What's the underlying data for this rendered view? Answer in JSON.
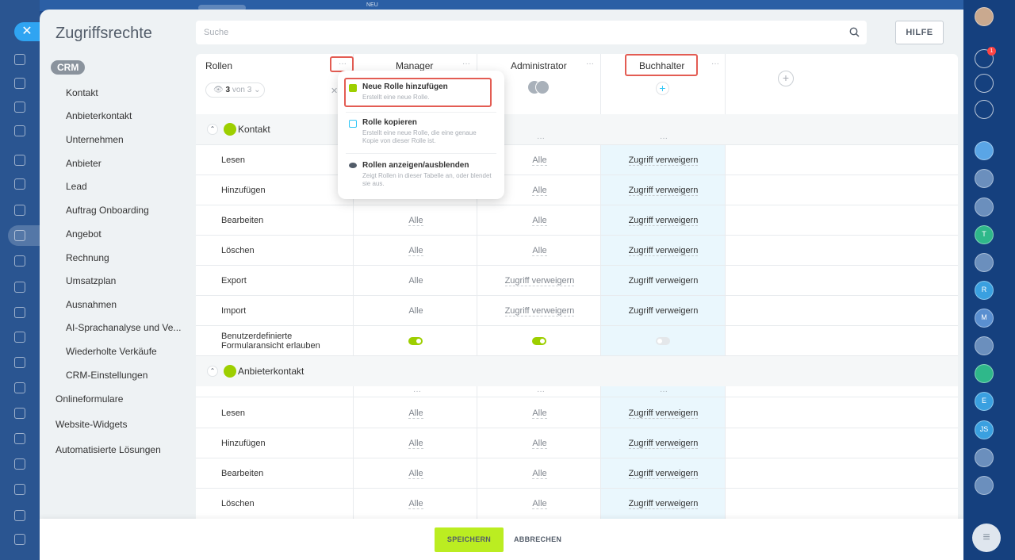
{
  "panel": {
    "title": "Zugriffsrechte",
    "search_placeholder": "Suche",
    "help_label": "HILFE"
  },
  "topbar": {
    "new_label": "NEU"
  },
  "nav": {
    "crm_label": "CRM",
    "crm_items": [
      "Kontakt",
      "Anbieterkontakt",
      "Unternehmen",
      "Anbieter",
      "Lead",
      "Auftrag Onboarding",
      "Angebot",
      "Rechnung",
      "Umsatzplan",
      "Ausnahmen",
      "AI-Sprachanalyse und Ve...",
      "Wiederholte Verkäufe",
      "CRM-Einstellungen"
    ],
    "top_items": [
      "Onlineformulare",
      "Website-Widgets",
      "Automatisierte Lösungen"
    ]
  },
  "table": {
    "roles_header": "Rollen",
    "count": "3",
    "count_suffix": "von 3",
    "columns": [
      "Manager",
      "Administrator",
      "Buchhalter"
    ],
    "sections": [
      {
        "title": "Kontakt",
        "rows": [
          {
            "label": "Lesen",
            "values": [
              "",
              "Alle",
              "Zugriff verweigern"
            ]
          },
          {
            "label": "Hinzufügen",
            "values": [
              "",
              "Alle",
              "Zugriff verweigern"
            ]
          },
          {
            "label": "Bearbeiten",
            "values": [
              "Alle",
              "Alle",
              "Zugriff verweigern"
            ]
          },
          {
            "label": "Löschen",
            "values": [
              "Alle",
              "Alle",
              "Zugriff verweigern"
            ]
          },
          {
            "label": "Export",
            "values": [
              "Alle",
              "Zugriff verweigern",
              "Zugriff verweigern"
            ]
          },
          {
            "label": "Import",
            "values": [
              "Alle",
              "Zugriff verweigern",
              "Zugriff verweigern"
            ]
          },
          {
            "label": "Benutzerdefinierte Formularansicht erlauben",
            "toggles": [
              true,
              true,
              false
            ]
          }
        ]
      },
      {
        "title": "Anbieterkontakt",
        "rows": [
          {
            "label": "Lesen",
            "values": [
              "Alle",
              "Alle",
              "Zugriff verweigern"
            ]
          },
          {
            "label": "Hinzufügen",
            "values": [
              "Alle",
              "Alle",
              "Zugriff verweigern"
            ]
          },
          {
            "label": "Bearbeiten",
            "values": [
              "Alle",
              "Alle",
              "Zugriff verweigern"
            ]
          },
          {
            "label": "Löschen",
            "values": [
              "Alle",
              "Alle",
              "Zugriff verweigern"
            ]
          }
        ]
      }
    ]
  },
  "menu": {
    "items": [
      {
        "title": "Neue Rolle hinzufügen",
        "desc": "Erstellt eine neue Rolle."
      },
      {
        "title": "Rolle kopieren",
        "desc": "Erstellt eine neue Rolle, die eine genaue Kopie von dieser Rolle ist."
      },
      {
        "title": "Rollen anzeigen/ausblenden",
        "desc": "Zeigt Rollen in dieser Tabelle an, oder blendet sie aus."
      }
    ]
  },
  "footer": {
    "save_label": "SPEICHERN",
    "cancel_label": "ABBRECHEN"
  },
  "rightbar": {
    "notification_count": "1",
    "avatar_letters": [
      "T",
      "R",
      "M",
      "E",
      "JS"
    ]
  },
  "colors": {
    "accent_green": "#bbed21",
    "highlight_red": "#e35c53",
    "buchhalter_bg": "#eaf7fd"
  }
}
